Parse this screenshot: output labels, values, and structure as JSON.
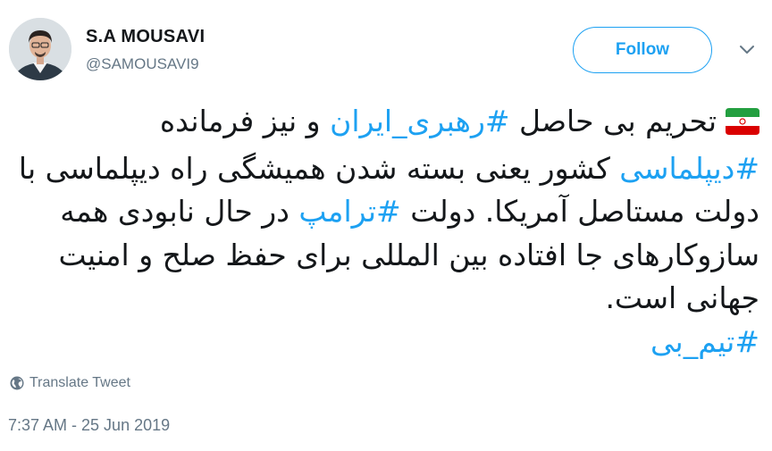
{
  "user": {
    "display_name": "S.A MOUSAVI",
    "handle": "@SAMOUSAVI9"
  },
  "follow_label": "Follow",
  "tweet": {
    "flag_icon": "iran-flag-icon",
    "text_1": "تحریم بی حاصل ",
    "hashtag_1": "#رهبری_ایران",
    "text_2": " و نیز فرمانده ",
    "hashtag_2": "#دیپلماسی",
    "text_3": " کشور یعنی بسته شدن همیشگی راه دیپلماسی با دولت مستاصل آمریکا. دولت ",
    "hashtag_3": "#ترامپ",
    "text_4": " در حال نابودی همه سازوکارهای جا افتاده بین المللی برای حفظ صلح و امنیت جهانی است.",
    "hashtag_4": "#تیم_بی"
  },
  "translate_label": "Translate Tweet",
  "timestamp": "7:37 AM - 25 Jun 2019",
  "colors": {
    "accent": "#1da1f2",
    "text": "#14171a",
    "muted": "#657786"
  }
}
